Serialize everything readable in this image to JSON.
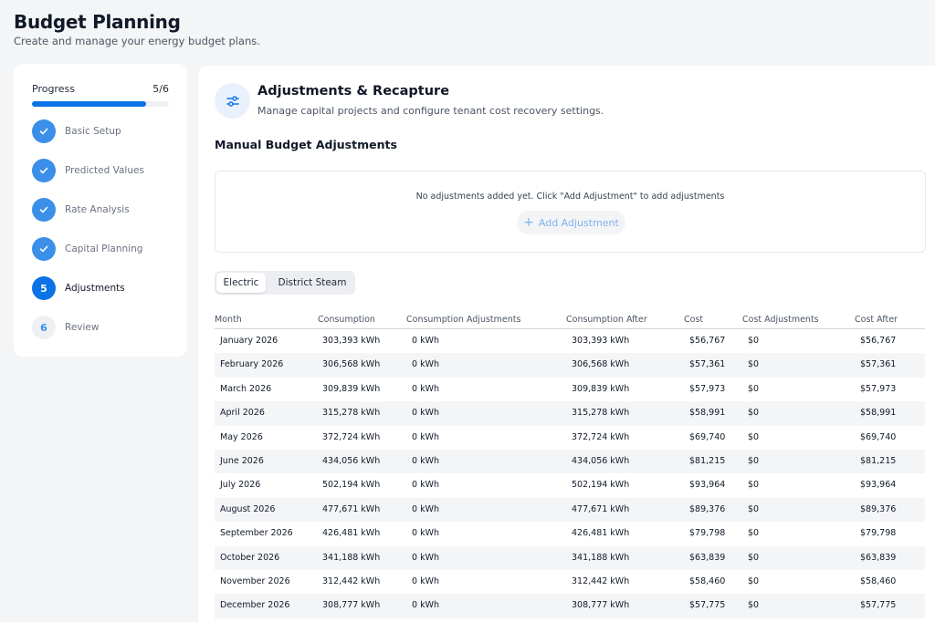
{
  "page": {
    "title": "Budget Planning",
    "subtitle": "Create and manage your energy budget plans."
  },
  "progress": {
    "label": "Progress",
    "count": "5/6",
    "fraction": 0.833
  },
  "steps": [
    {
      "label": "Basic Setup",
      "status": "done",
      "marker": ""
    },
    {
      "label": "Predicted Values",
      "status": "done",
      "marker": ""
    },
    {
      "label": "Rate Analysis",
      "status": "done",
      "marker": ""
    },
    {
      "label": "Capital Planning",
      "status": "done",
      "marker": ""
    },
    {
      "label": "Adjustments",
      "status": "active",
      "marker": "5"
    },
    {
      "label": "Review",
      "status": "pending",
      "marker": "6"
    }
  ],
  "section": {
    "title": "Adjustments & Recapture",
    "subtitle": "Manage capital projects and configure tenant cost recovery settings.",
    "icon": "sliders-icon"
  },
  "manual": {
    "title": "Manual Budget Adjustments",
    "empty_text": "No adjustments added yet. Click \"Add Adjustment\" to add adjustments",
    "add_button_label": "Add Adjustment"
  },
  "tabs": [
    {
      "label": "Electric",
      "active": true
    },
    {
      "label": "District Steam",
      "active": false
    }
  ],
  "table": {
    "headers": [
      "Month",
      "Consumption",
      "Consumption Adjustments",
      "Consumption After",
      "Cost",
      "Cost Adjustments",
      "Cost After"
    ],
    "rows": [
      [
        "January 2026",
        "303,393 kWh",
        "0 kWh",
        "303,393 kWh",
        "$56,767",
        "$0",
        "$56,767"
      ],
      [
        "February 2026",
        "306,568 kWh",
        "0 kWh",
        "306,568 kWh",
        "$57,361",
        "$0",
        "$57,361"
      ],
      [
        "March 2026",
        "309,839 kWh",
        "0 kWh",
        "309,839 kWh",
        "$57,973",
        "$0",
        "$57,973"
      ],
      [
        "April 2026",
        "315,278 kWh",
        "0 kWh",
        "315,278 kWh",
        "$58,991",
        "$0",
        "$58,991"
      ],
      [
        "May 2026",
        "372,724 kWh",
        "0 kWh",
        "372,724 kWh",
        "$69,740",
        "$0",
        "$69,740"
      ],
      [
        "June 2026",
        "434,056 kWh",
        "0 kWh",
        "434,056 kWh",
        "$81,215",
        "$0",
        "$81,215"
      ],
      [
        "July 2026",
        "502,194 kWh",
        "0 kWh",
        "502,194 kWh",
        "$93,964",
        "$0",
        "$93,964"
      ],
      [
        "August 2026",
        "477,671 kWh",
        "0 kWh",
        "477,671 kWh",
        "$89,376",
        "$0",
        "$89,376"
      ],
      [
        "September 2026",
        "426,481 kWh",
        "0 kWh",
        "426,481 kWh",
        "$79,798",
        "$0",
        "$79,798"
      ],
      [
        "October 2026",
        "341,188 kWh",
        "0 kWh",
        "341,188 kWh",
        "$63,839",
        "$0",
        "$63,839"
      ],
      [
        "November 2026",
        "312,442 kWh",
        "0 kWh",
        "312,442 kWh",
        "$58,460",
        "$0",
        "$58,460"
      ],
      [
        "December 2026",
        "308,777 kWh",
        "0 kWh",
        "308,777 kWh",
        "$57,775",
        "$0",
        "$57,775"
      ]
    ]
  },
  "colors": {
    "accent": "#0b73e6",
    "done": "#3b8fe8"
  }
}
